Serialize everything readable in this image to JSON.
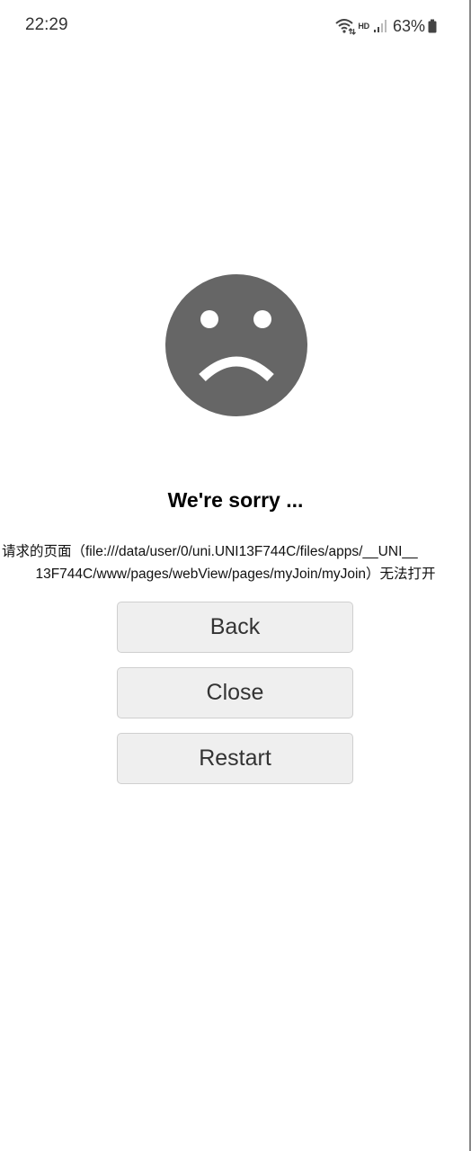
{
  "status_bar": {
    "time": "22:29",
    "network_label": "HD",
    "battery_percent": "63%",
    "icons": [
      "wifi-icon",
      "signal-icon",
      "battery-icon"
    ]
  },
  "error": {
    "icon": "sad-face-icon",
    "title": "We're sorry ...",
    "message_line1": "请求的页面（file:///data/user/0/uni.UNI13F744C/files/apps/__UNI__",
    "message_line2": "13F744C/www/pages/webView/pages/myJoin/myJoin）无法打开"
  },
  "buttons": {
    "back": "Back",
    "close": "Close",
    "restart": "Restart"
  },
  "colors": {
    "face": "#666666",
    "button_bg": "#efefef",
    "button_border": "#cfcfcf"
  }
}
